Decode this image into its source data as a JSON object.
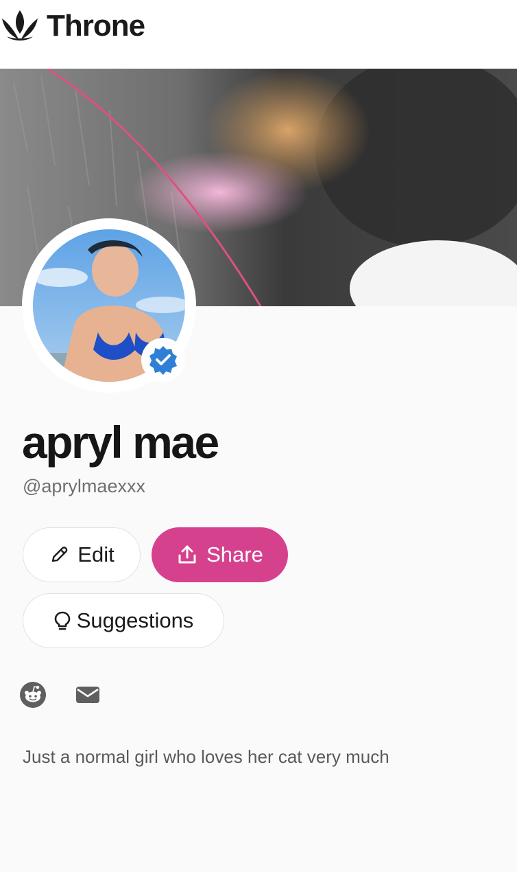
{
  "brand": {
    "name": "Throne",
    "logo_icon": "crown-leaf-icon"
  },
  "profile": {
    "display_name": "apryl mae",
    "handle": "@aprylmaexxx",
    "verified": true,
    "bio": "Just a normal girl who loves her cat very much"
  },
  "actions": {
    "edit_label": "Edit",
    "share_label": "Share",
    "suggestions_label": "Suggestions"
  },
  "social_links": [
    {
      "name": "reddit",
      "icon": "reddit-icon"
    },
    {
      "name": "email",
      "icon": "envelope-icon"
    }
  ],
  "colors": {
    "accent": "#d6418e",
    "verified_badge": "#2f7fd6",
    "background": "#fafafa"
  }
}
